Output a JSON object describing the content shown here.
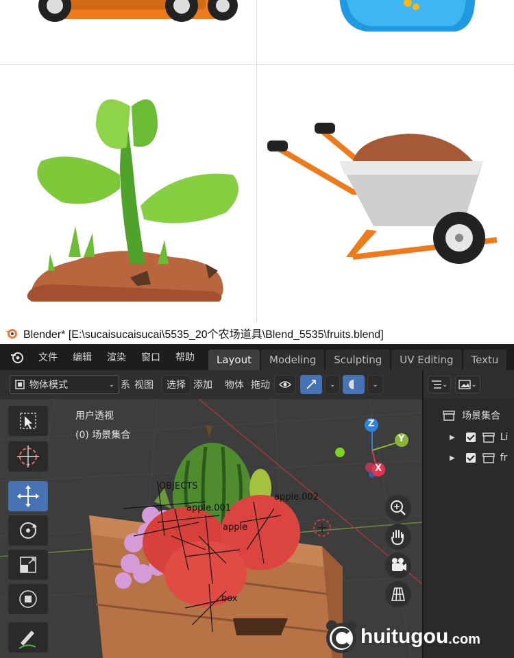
{
  "window": {
    "title": "Blender* [E:\\sucaisucaisucai\\5535_20个农场道具\\Blend_5535\\fruits.blend]"
  },
  "menubar": {
    "file": "文件",
    "edit": "编辑",
    "render": "渲染",
    "window": "窗口",
    "help": "帮助"
  },
  "workspace_tabs": [
    {
      "label": "Layout",
      "active": true
    },
    {
      "label": "Modeling",
      "active": false
    },
    {
      "label": "Sculpting",
      "active": false
    },
    {
      "label": "UV Editing",
      "active": false
    },
    {
      "label": "Textu",
      "active": false
    }
  ],
  "viewport_header": {
    "mode": "物体模式",
    "mode_suffix": "系",
    "view": "视图",
    "select": "选择",
    "add": "添加",
    "object": "物体",
    "drag": "拖动"
  },
  "viewport": {
    "perspective_label": "用户透视",
    "collection_label": "(0) 场景集合",
    "objects": {
      "objects_label": "OBJECTS",
      "apple_001": "apple.001",
      "apple_002": "apple.002",
      "apple": "apple",
      "box": "box"
    },
    "axes": {
      "x": "X",
      "y": "Y",
      "z": "Z"
    }
  },
  "outliner": {
    "scene_collection": "场景集合",
    "items": [
      {
        "label": "Li"
      },
      {
        "label": "fr"
      }
    ]
  },
  "watermark": {
    "text": "huitugou",
    "suffix": ".com"
  },
  "colors": {
    "accent_blue": "#4772b3",
    "axis_x": "#e8324a",
    "axis_y": "#8bb43c",
    "axis_z": "#2f83e0",
    "orange": "#f07a1a"
  }
}
